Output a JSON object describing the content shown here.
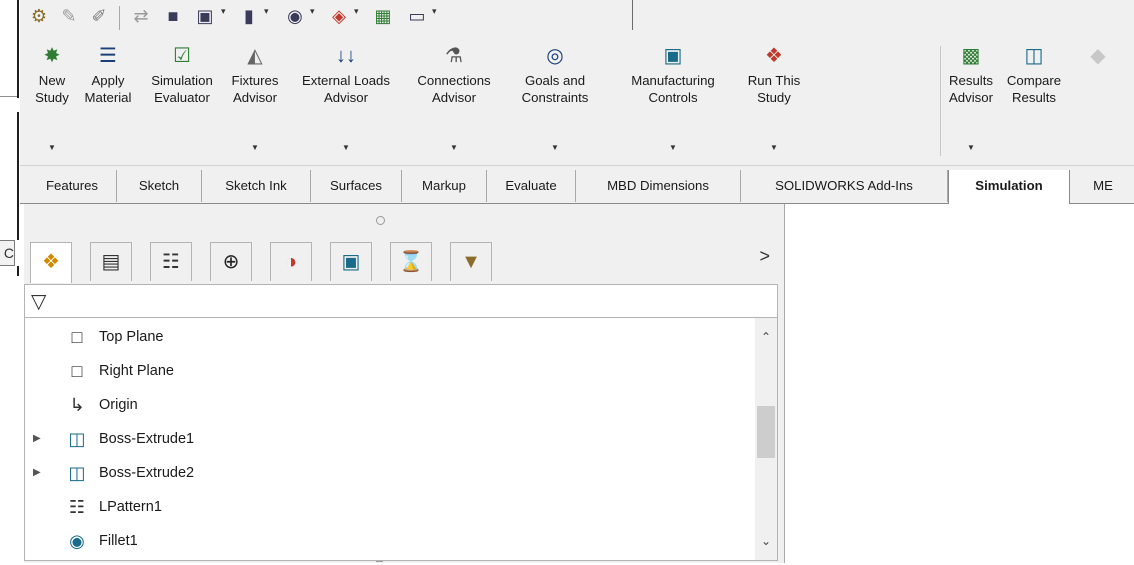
{
  "quick_access": {
    "icons": [
      "wrench-icon",
      "sketch-icon",
      "pencil-icon",
      "dim-icon",
      "hammer-icon",
      "view-icon",
      "display-icon",
      "section-icon",
      "appearance-icon",
      "scene-icon",
      "monitor-icon"
    ]
  },
  "command_manager": {
    "buttons": [
      {
        "label": "New\nStudy",
        "icon": "new-study-icon",
        "has_dropdown": true
      },
      {
        "label": "Apply\nMaterial",
        "icon": "apply-material-icon",
        "has_dropdown": false
      },
      {
        "label": "Simulation\nEvaluator",
        "icon": "simulation-evaluator-icon",
        "has_dropdown": false
      },
      {
        "label": "Fixtures\nAdvisor",
        "icon": "fixtures-advisor-icon",
        "has_dropdown": true
      },
      {
        "label": "External Loads\nAdvisor",
        "icon": "external-loads-icon",
        "has_dropdown": true
      },
      {
        "label": "Connections\nAdvisor",
        "icon": "connections-advisor-icon",
        "has_dropdown": true
      },
      {
        "label": "Goals and\nConstraints",
        "icon": "goals-constraints-icon",
        "has_dropdown": true
      },
      {
        "label": "Manufacturing\nControls",
        "icon": "manufacturing-controls-icon",
        "has_dropdown": true
      },
      {
        "label": "Run This\nStudy",
        "icon": "run-study-icon",
        "has_dropdown": true
      },
      {
        "label": "Results\nAdvisor",
        "icon": "results-advisor-icon",
        "has_dropdown": true
      },
      {
        "label": "Compare\nResults",
        "icon": "compare-results-icon",
        "has_dropdown": false
      }
    ]
  },
  "tabs": [
    {
      "label": "Features",
      "active": false
    },
    {
      "label": "Sketch",
      "active": false
    },
    {
      "label": "Sketch Ink",
      "active": false
    },
    {
      "label": "Surfaces",
      "active": false
    },
    {
      "label": "Markup",
      "active": false
    },
    {
      "label": "Evaluate",
      "active": false
    },
    {
      "label": "MBD Dimensions",
      "active": false
    },
    {
      "label": "SOLIDWORKS Add-Ins",
      "active": false
    },
    {
      "label": "Simulation",
      "active": true
    },
    {
      "label": "ME",
      "active": false
    }
  ],
  "left_pane": {
    "left_strip_char": "C",
    "tab_icons": [
      "feature-manager-icon",
      "property-manager-icon",
      "configuration-manager-icon",
      "dimxpert-icon",
      "display-manager-icon",
      "cam-icon",
      "simulation-tree-icon",
      "tool-icon"
    ],
    "more_glyph": ">",
    "filter_icon": "filter-icon",
    "tree": [
      {
        "label": "Top Plane",
        "icon": "plane-icon",
        "expandable": false
      },
      {
        "label": "Right Plane",
        "icon": "plane-icon",
        "expandable": false
      },
      {
        "label": "Origin",
        "icon": "origin-icon",
        "expandable": false
      },
      {
        "label": "Boss-Extrude1",
        "icon": "extrude-icon",
        "expandable": true
      },
      {
        "label": "Boss-Extrude2",
        "icon": "extrude-icon",
        "expandable": true
      },
      {
        "label": "LPattern1",
        "icon": "pattern-icon",
        "expandable": false
      },
      {
        "label": "Fillet1",
        "icon": "fillet-icon",
        "expandable": false
      }
    ]
  },
  "colors": {
    "chrome": "#f0f0f0",
    "border": "#b4b4b4",
    "active_tab": "#ffffff",
    "text": "#1a1a1a"
  }
}
